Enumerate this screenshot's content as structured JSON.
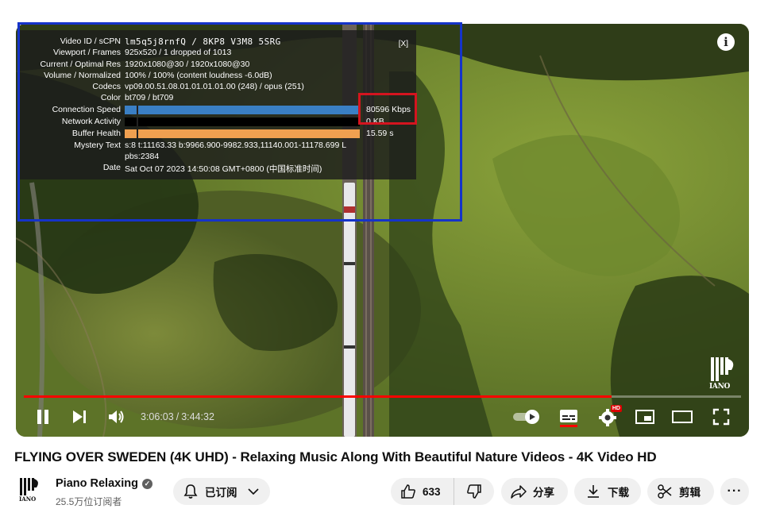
{
  "player": {
    "info_icon": "i",
    "stats": {
      "close": "[X]",
      "rows": [
        {
          "label": "Video ID / sCPN",
          "value": "lm5q5j8rnfQ / 8KP8 V3M8 5SRG"
        },
        {
          "label": "Viewport / Frames",
          "value": "925x520 / 1 dropped of 1013"
        },
        {
          "label": "Current / Optimal Res",
          "value": "1920x1080@30 / 1920x1080@30"
        },
        {
          "label": "Volume / Normalized",
          "value": "100% / 100% (content loudness -6.0dB)"
        },
        {
          "label": "Codecs",
          "value": "vp09.00.51.08.01.01.01.01.00 (248) / opus (251)"
        },
        {
          "label": "Color",
          "value": "bt709 / bt709"
        },
        {
          "label": "Connection Speed",
          "value": "80596 Kbps",
          "fill": 1.0,
          "color": "#3a7fc4"
        },
        {
          "label": "Network Activity",
          "value": "0 KB",
          "fill": 0.0,
          "color": "#3a7fc4"
        },
        {
          "label": "Buffer Health",
          "value": "15.59 s",
          "fill": 1.0,
          "color": "#f0a050"
        },
        {
          "label": "Mystery Text",
          "value": "s:8 t:11163.33 b:9966.900-9982.933,11140.001-11178.699 L",
          "value2": "pbs:2384"
        },
        {
          "label": "Date",
          "value": "Sat Oct 07 2023 14:50:08 GMT+0800 (中国标准时间)"
        }
      ]
    },
    "watermark_text": "IANO",
    "progress": {
      "played_fraction": 0.8196
    },
    "time": {
      "current": "3:06:03",
      "separator": "/",
      "duration": "3:44:32"
    },
    "settings_badge": "HD"
  },
  "video": {
    "title": "FLYING OVER SWEDEN (4K UHD) - Relaxing Music Along With Beautiful Nature Videos - 4K Video HD"
  },
  "channel": {
    "name": "Piano Relaxing",
    "verified_mark": "✓",
    "subscribers": "25.5万位订阅者"
  },
  "actions": {
    "subscribed_label": "已订阅",
    "likes": "633",
    "share_label": "分享",
    "download_label": "下载",
    "clip_label": "剪辑",
    "more_label": "···"
  },
  "colors": {
    "progress_red": "#ff0000",
    "highlight_blue": "#1533c9",
    "highlight_red": "#d4141f"
  }
}
